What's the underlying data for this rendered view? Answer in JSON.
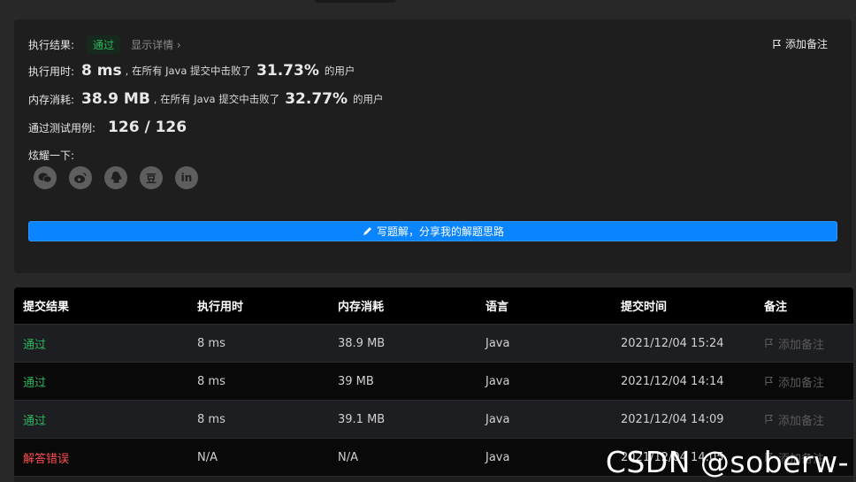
{
  "result": {
    "label": "执行结果:",
    "status": "通过",
    "details_link": "显示详情 ›",
    "add_note": "添加备注",
    "runtime": {
      "label": "执行用时:",
      "value": "8 ms",
      "mid": ", 在所有 Java 提交中击败了",
      "percent": "31.73%",
      "suffix": "的用户"
    },
    "memory": {
      "label": "内存消耗:",
      "value": "38.9 MB",
      "mid": ", 在所有 Java 提交中击败了",
      "percent": "32.77%",
      "suffix": "的用户"
    },
    "tests": {
      "label": "通过测试用例:",
      "value": "126 / 126"
    },
    "share_label": "炫耀一下:",
    "share_icons": [
      "wechat-icon",
      "weibo-icon",
      "qq-icon",
      "douban-icon",
      "linkedin-icon"
    ],
    "douban_glyph": "豆",
    "linkedin_glyph": "in",
    "write_solution": "写题解，分享我的解题思路"
  },
  "table": {
    "headers": [
      "提交结果",
      "执行用时",
      "内存消耗",
      "语言",
      "提交时间",
      "备注"
    ],
    "rows": [
      {
        "status": "通过",
        "time": "8 ms",
        "memory": "38.9 MB",
        "lang": "Java",
        "submitted": "2021/12/04 15:24",
        "note": "添加备注"
      },
      {
        "status": "通过",
        "time": "8 ms",
        "memory": "39 MB",
        "lang": "Java",
        "submitted": "2021/12/04 14:14",
        "note": "添加备注"
      },
      {
        "status": "通过",
        "time": "8 ms",
        "memory": "39.1 MB",
        "lang": "Java",
        "submitted": "2021/12/04 14:09",
        "note": "添加备注"
      },
      {
        "status": "解答错误",
        "time": "N/A",
        "memory": "N/A",
        "lang": "Java",
        "submitted": "2021/12/04 14:05",
        "note": "添加备注"
      }
    ]
  },
  "watermark": "CSDN @soberw-",
  "colors": {
    "accent": "#0a84ff",
    "success": "#2db55d",
    "error": "#ff4d4f"
  }
}
